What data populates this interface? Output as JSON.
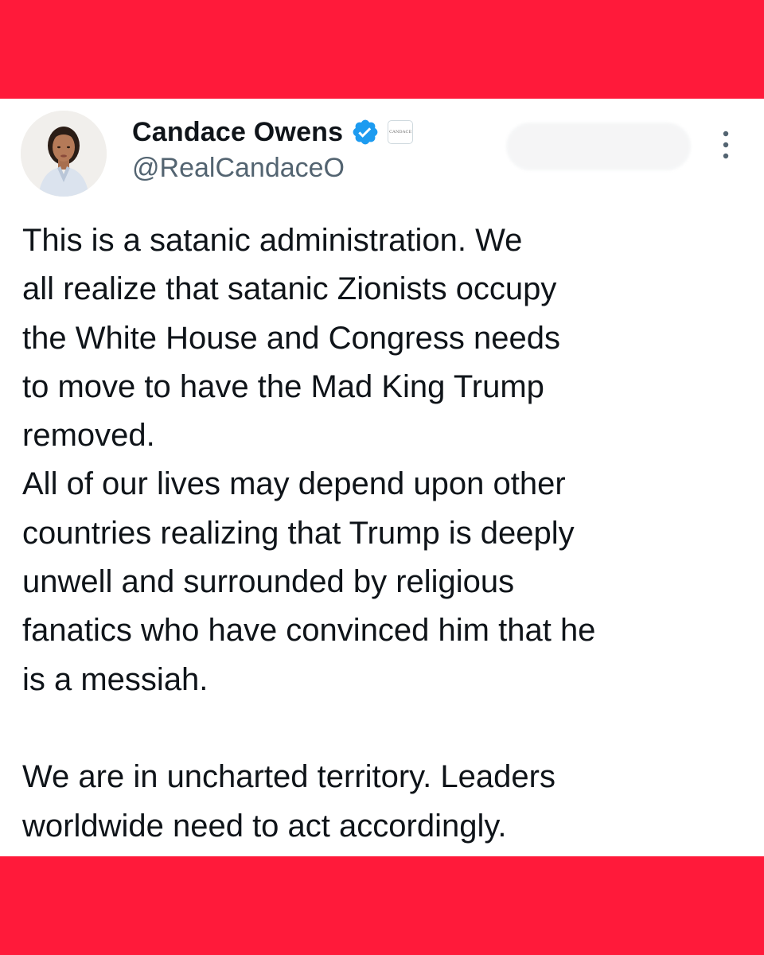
{
  "colors": {
    "band": "#ff1a3a",
    "card_background": "#ffffff",
    "name_text": "#0f1419",
    "handle_text": "#536471",
    "verified_badge": "#1d9bf0"
  },
  "tweet": {
    "author": {
      "display_name": "Candace Owens",
      "handle": "@RealCandaceO",
      "verified_icon": "verified-badge-icon",
      "affiliate_badge_text": "CANDACE",
      "avatar_icon": "profile-avatar"
    },
    "more_icon": "more-options-icon",
    "text_lines": [
      "This is a satanic administration. We",
      "all realize that satanic Zionists occupy",
      "the White House and Congress needs",
      "to move to have the Mad King Trump",
      "removed.",
      "All of our lives may depend upon other",
      "countries realizing that Trump is deeply",
      "unwell and surrounded by religious",
      "fanatics who have convinced him that he",
      "is a messiah.",
      "",
      "We are in uncharted territory. Leaders",
      "worldwide need to act accordingly."
    ]
  }
}
